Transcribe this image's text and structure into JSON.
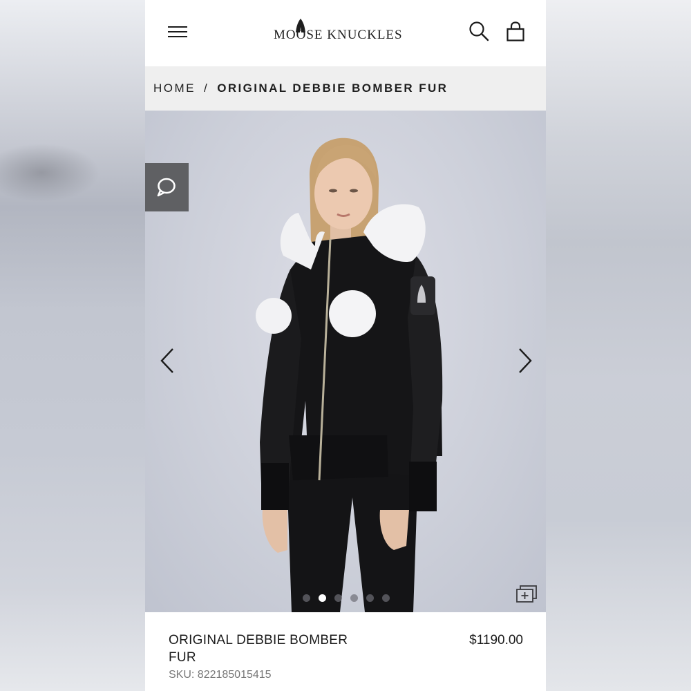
{
  "header": {
    "brand": "MOOSE KNUCKLES",
    "menu_icon": "hamburger-menu-icon",
    "search_icon": "search-icon",
    "bag_icon": "shopping-bag-icon"
  },
  "breadcrumb": {
    "home": "HOME",
    "separator": "/",
    "current": "ORIGINAL DEBBIE BOMBER FUR"
  },
  "gallery": {
    "image": "model-wearing-black-bomber-jacket-with-white-fur-hood-and-pom-poms",
    "chat_icon": "chat-bubble-icon",
    "prev_icon": "chevron-left-icon",
    "next_icon": "chevron-right-icon",
    "zoom_icon": "expand-images-icon",
    "dot_count": 6,
    "active_dot": 2
  },
  "product": {
    "name": "ORIGINAL DEBBIE BOMBER FUR",
    "price": "$1190.00",
    "sku": "SKU: 822185015415"
  },
  "colors": {
    "accent": "#1b1b1b",
    "breadcrumb_bg": "#efefef",
    "chat_button_bg": "#5f6063",
    "jacket": "#151517",
    "fur": "#f3f3f5"
  }
}
